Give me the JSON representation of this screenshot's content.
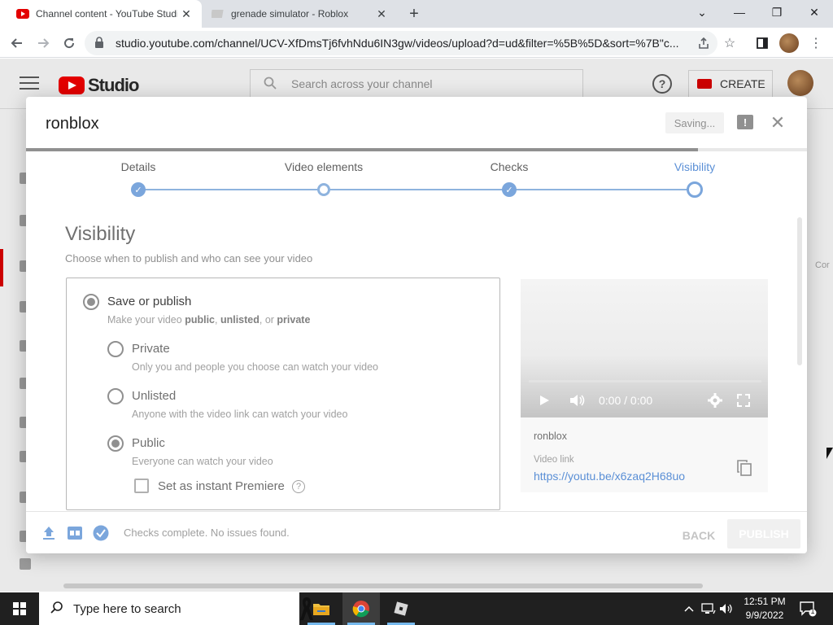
{
  "browser": {
    "tabs": [
      {
        "title": "Channel content - YouTube Studio",
        "active": true
      },
      {
        "title": "grenade simulator - Roblox",
        "active": false
      }
    ],
    "new_tab_label": "+",
    "window_controls": {
      "minimize": "—",
      "restore": "❐",
      "close": "✕",
      "tab_search": "⌄"
    },
    "url": "studio.youtube.com/channel/UCV-XfDmsTj6fvhNdu6IN3gw/videos/upload?d=ud&filter=%5B%5D&sort=%7B\"c..."
  },
  "studio": {
    "logo_text": "Studio",
    "search_placeholder": "Search across your channel",
    "help_label": "?",
    "create_label": "CREATE",
    "side_text": "Cor"
  },
  "dialog": {
    "title": "ronblox",
    "saving_label": "Saving...",
    "feedback_label": "!",
    "close_label": "✕",
    "upload_progress": 0.86,
    "steps": [
      {
        "label": "Details",
        "state": "done"
      },
      {
        "label": "Video elements",
        "state": "open"
      },
      {
        "label": "Checks",
        "state": "done"
      },
      {
        "label": "Visibility",
        "state": "current"
      }
    ],
    "section_title": "Visibility",
    "section_subtitle": "Choose when to publish and who can see your video",
    "save_publish": {
      "label": "Save or publish",
      "desc_prefix": "Make your video ",
      "desc_public": "public",
      "desc_sep1": ", ",
      "desc_unlisted": "unlisted",
      "desc_sep2": ", or ",
      "desc_private": "private"
    },
    "options": [
      {
        "label": "Private",
        "desc": "Only you and people you choose can watch your video",
        "checked": false
      },
      {
        "label": "Unlisted",
        "desc": "Anyone with the video link can watch your video",
        "checked": false
      },
      {
        "label": "Public",
        "desc": "Everyone can watch your video",
        "checked": true
      }
    ],
    "premiere_label": "Set as instant Premiere",
    "premiere_help": "?",
    "preview": {
      "time": "0:00 / 0:00",
      "video_name": "ronblox",
      "link_label": "Video link",
      "link": "https://youtu.be/x6zaq2H68uo"
    },
    "footer": {
      "status": "Checks complete. No issues found.",
      "back_label": "BACK",
      "publish_label": "PUBLISH"
    }
  },
  "taskbar": {
    "search_placeholder": "Type here to search",
    "time": "12:51 PM",
    "date": "9/9/2022",
    "notification_count": "1"
  },
  "colors": {
    "accent_blue": "#5a8fd6",
    "youtube_red": "#e30000",
    "taskbar_bg": "#202020"
  }
}
